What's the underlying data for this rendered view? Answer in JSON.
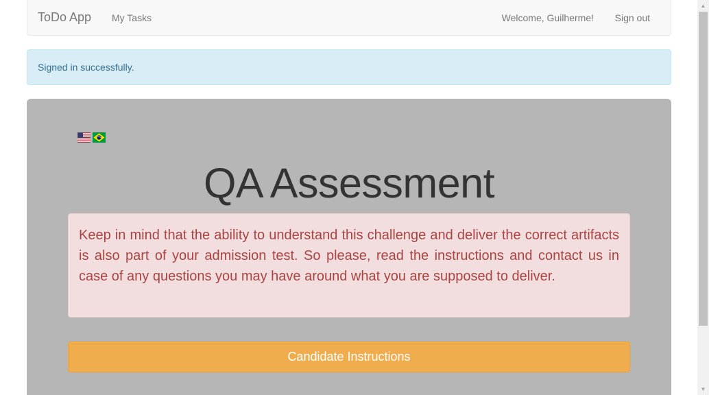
{
  "navbar": {
    "brand": "ToDo App",
    "my_tasks": "My Tasks",
    "welcome": "Welcome, Guilherme!",
    "sign_out": "Sign out"
  },
  "flash": {
    "message": "Signed in successfully."
  },
  "main": {
    "flags": [
      {
        "icon": "us-flag-icon"
      },
      {
        "icon": "brazil-flag-icon"
      }
    ],
    "title": "QA Assessment",
    "notice": "Keep in mind that the ability to understand this challenge and deliver the correct artifacts is also part of your admission test. So please, read the instructions and contact us in case of any questions you may have around what you are supposed to deliver.",
    "instructions_button": "Candidate Instructions"
  },
  "colors": {
    "jumbotron_bg": "#b6b6b6",
    "info_bg": "#d9edf7",
    "danger_bg": "#f2dede",
    "warning_button": "#f0ad4e"
  }
}
